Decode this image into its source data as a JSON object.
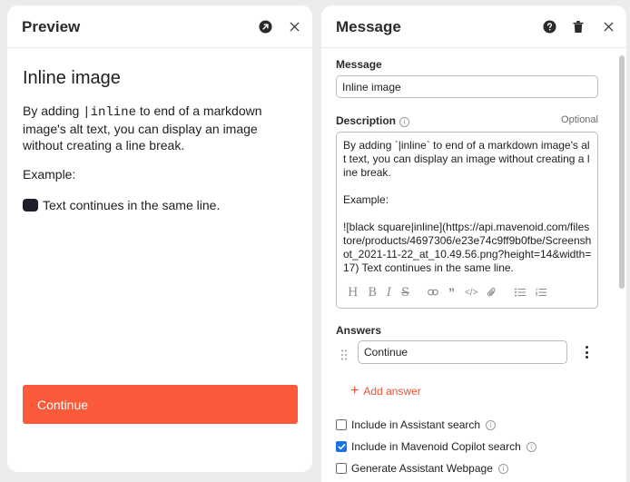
{
  "preview": {
    "title": "Preview",
    "heading": "Inline image",
    "body_pre": "By adding ",
    "body_code": "|inline",
    "body_post": " to end of a markdown image's alt text, you can display an image without creating a line break.",
    "example_label": "Example:",
    "inline_text": "Text continues in the same line.",
    "button_label": "Continue",
    "button_color": "#fb5a3a"
  },
  "message_panel": {
    "title": "Message",
    "message_label": "Message",
    "message_value": "Inline image",
    "description_label": "Description",
    "optional_label": "Optional",
    "description_value": "By adding `|inline` to end of a markdown image's alt text, you can display an image without creating a line break.\n\nExample:\n\n![black square|inline](https://api.mavenoid.com/filestore/products/4697306/e23e74c9ff9b0fbe/Screenshot_2021-11-22_at_10.49.56.png?height=14&width=17) Text continues in the same line.",
    "answers_label": "Answers",
    "answer_value": "Continue",
    "add_answer_label": "Add answer",
    "checkboxes": [
      {
        "label": "Include in Assistant search",
        "checked": false
      },
      {
        "label": "Include in Mavenoid Copilot search",
        "checked": true
      },
      {
        "label": "Generate Assistant Webpage",
        "checked": false
      }
    ],
    "accent_color": "#f0502f",
    "check_color": "#1a73e8"
  }
}
